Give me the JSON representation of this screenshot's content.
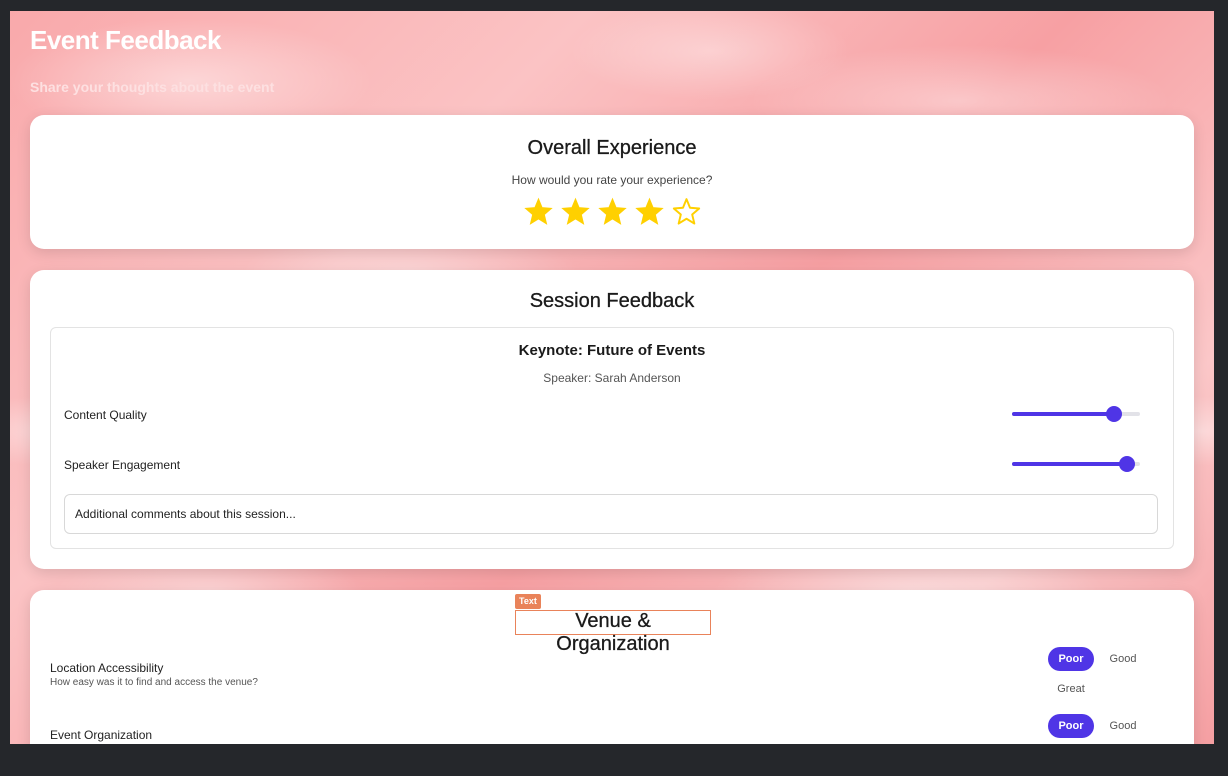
{
  "header": {
    "title": "Event Feedback",
    "subtitle": "Share your thoughts about the event"
  },
  "overall": {
    "title": "Overall Experience",
    "question": "How would you rate your experience?",
    "rating": 4,
    "max_rating": 5,
    "star_color": "#FFD000"
  },
  "session": {
    "section_title": "Session Feedback",
    "name": "Keynote: Future of Events",
    "speaker": "Speaker: Sarah Anderson",
    "ratings": [
      {
        "label": "Content Quality",
        "value": 0.8
      },
      {
        "label": "Speaker Engagement",
        "value": 0.9
      }
    ],
    "comment_placeholder": "Additional comments about this session..."
  },
  "venue": {
    "section_title": "Venue & Organization",
    "tag": "Text",
    "questions": [
      {
        "label": "Location Accessibility",
        "description": "How easy was it to find and access the venue?",
        "options": [
          "Poor",
          "Good",
          "Great"
        ],
        "selected": "Poor"
      },
      {
        "label": "Event Organization",
        "description": "",
        "options": [
          "Poor",
          "Good"
        ],
        "selected": "Poor"
      }
    ]
  },
  "colors": {
    "accent": "#4F35E6",
    "highlight": "#E9835A"
  }
}
